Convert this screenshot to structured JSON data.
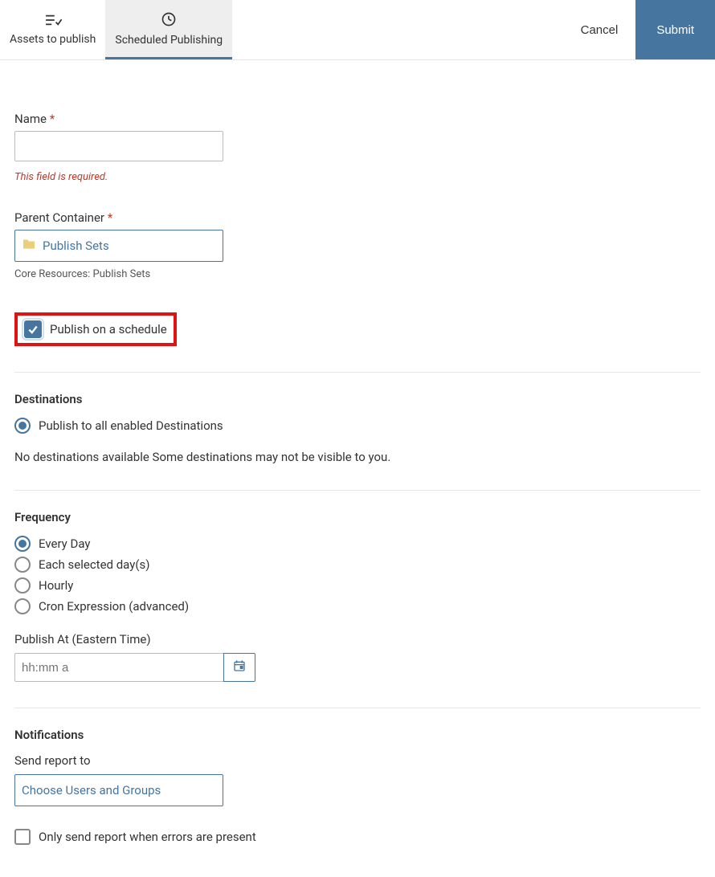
{
  "header": {
    "tabs": [
      {
        "label": "Assets to publish",
        "active": false
      },
      {
        "label": "Scheduled Publishing",
        "active": true
      }
    ],
    "cancel": "Cancel",
    "submit": "Submit"
  },
  "name_field": {
    "label": "Name",
    "value": "",
    "error": "This field is required."
  },
  "parent_field": {
    "label": "Parent Container",
    "value": "Publish Sets",
    "helper": "Core Resources: Publish Sets"
  },
  "schedule_checkbox": {
    "label": "Publish on a schedule",
    "checked": true
  },
  "destinations": {
    "title": "Destinations",
    "option": "Publish to all enabled Destinations",
    "message": "No destinations available Some destinations may not be visible to you."
  },
  "frequency": {
    "title": "Frequency",
    "options": [
      "Every Day",
      "Each selected day(s)",
      "Hourly",
      "Cron Expression (advanced)"
    ],
    "selected_index": 0,
    "publish_at_label": "Publish At (Eastern Time)",
    "publish_at_placeholder": "hh:mm a"
  },
  "notifications": {
    "title": "Notifications",
    "send_label": "Send report to",
    "picker_placeholder": "Choose Users and Groups",
    "error_only_label": "Only send report when errors are present",
    "error_only_checked": false
  }
}
